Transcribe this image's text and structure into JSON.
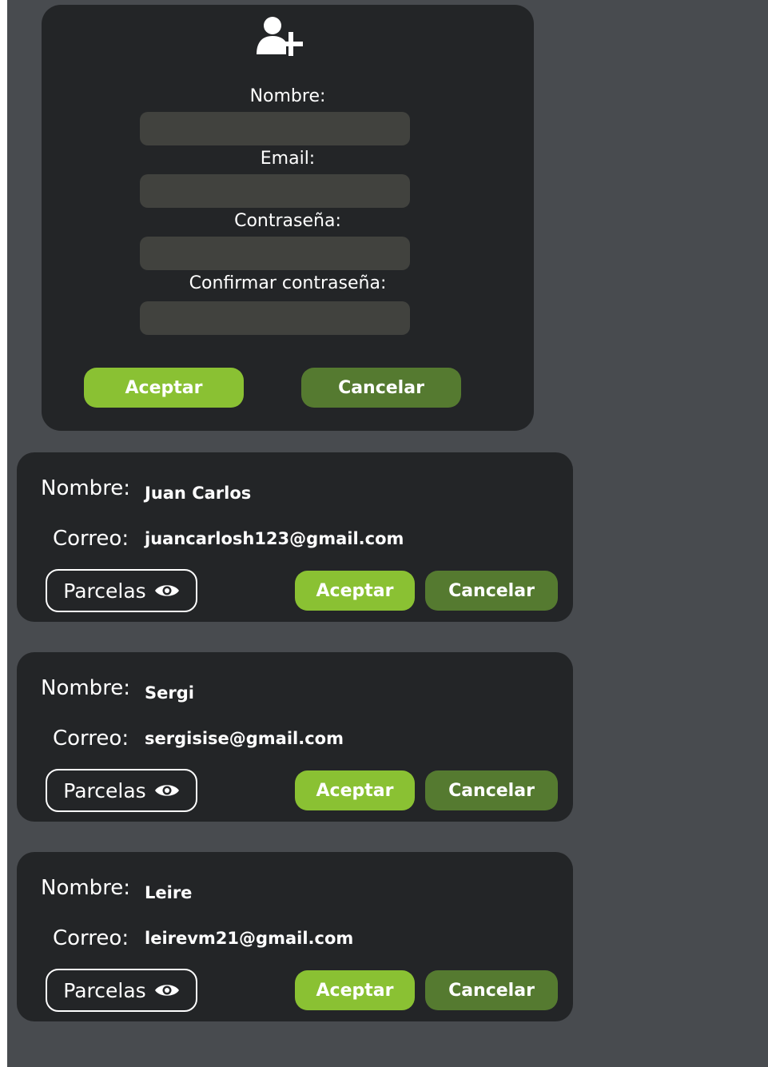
{
  "form": {
    "icon": "add-user-icon",
    "fields": [
      {
        "label": "Nombre:",
        "value": "",
        "placeholder": ""
      },
      {
        "label": "Email:",
        "value": "",
        "placeholder": ""
      },
      {
        "label": "Contraseña:",
        "value": "",
        "placeholder": ""
      },
      {
        "label": "Confirmar contraseña:",
        "value": "",
        "placeholder": ""
      }
    ],
    "accept_label": "Aceptar",
    "cancel_label": "Cancelar"
  },
  "user_labels": {
    "name": "Nombre:",
    "email": "Correo:",
    "parcelas": "Parcelas",
    "parcelas_icon": "eye-icon",
    "accept": "Aceptar",
    "cancel": "Cancelar"
  },
  "users": [
    {
      "name": "Juan Carlos",
      "email": "juancarlosh123@gmail.com"
    },
    {
      "name": "Sergi",
      "email": "sergisise@gmail.com"
    },
    {
      "name": "Leire",
      "email": "leirevm21@gmail.com"
    }
  ],
  "colors": {
    "page_bg": "#484b4f",
    "card_bg": "#232527",
    "input_bg": "#41423e",
    "accept": "#8ac133",
    "cancel": "#557a30",
    "text": "#ffffff"
  }
}
